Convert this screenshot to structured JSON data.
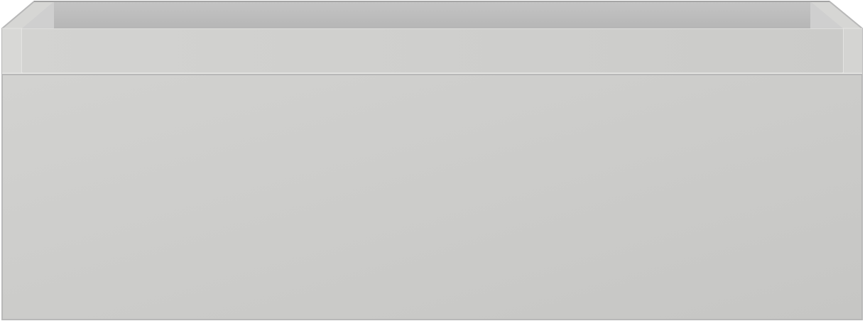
{
  "object": {
    "colors": {
      "background": "#ffffff",
      "outline": "#b8b8b8",
      "interior_back": "#bdbdbd",
      "interior_floor": "#c3c3c3",
      "interior_side": "#d0d0d0",
      "rim_top": "#d6d6d4",
      "rim_band": "#cfcfcd",
      "rim_band_top_edge": "#dededc",
      "drawer_front_light": "#d2d2d0",
      "drawer_front_dark": "#c6c6c4",
      "seam": "#e6e6e4"
    }
  }
}
